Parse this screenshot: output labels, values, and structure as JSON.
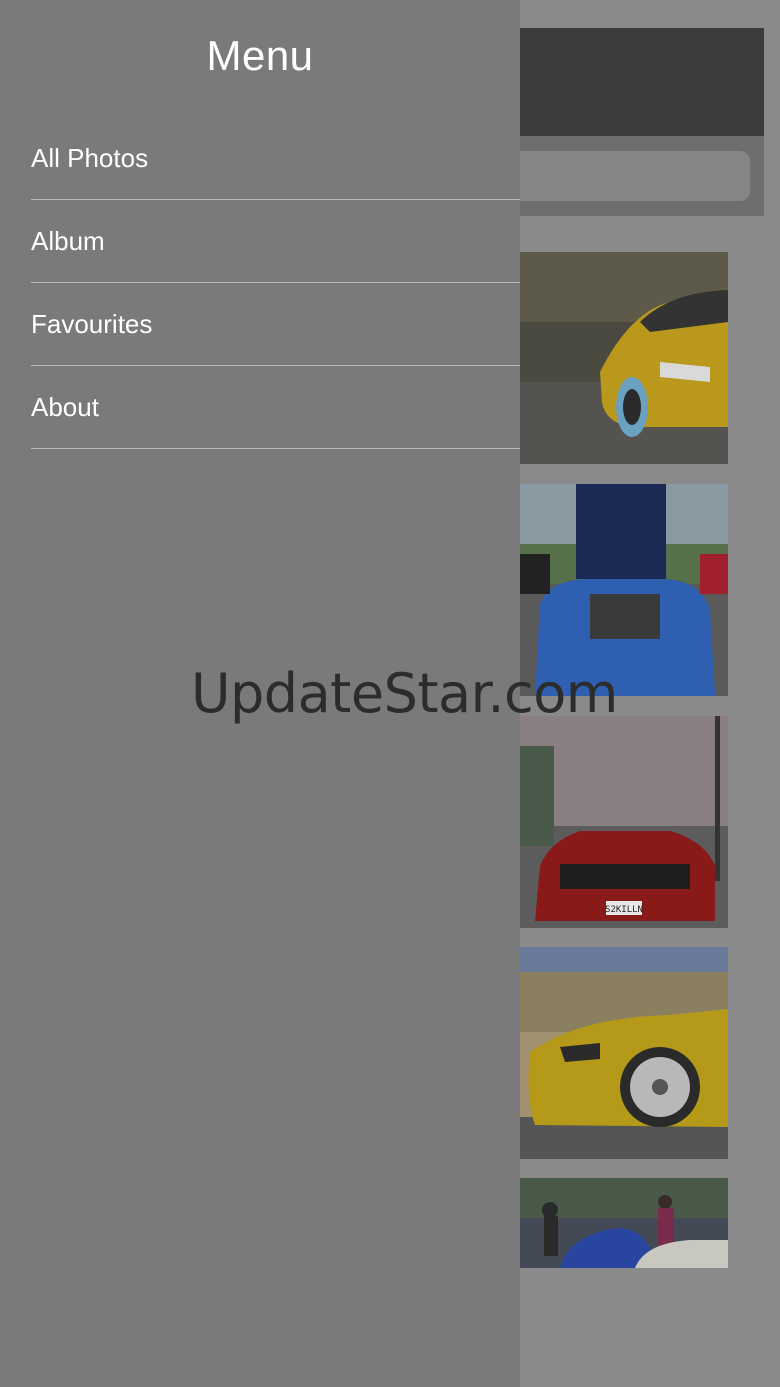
{
  "drawer": {
    "title": "Menu",
    "items": [
      {
        "label": "All Photos"
      },
      {
        "label": "Album"
      },
      {
        "label": "Favourites"
      },
      {
        "label": "About"
      }
    ]
  },
  "gallery": {
    "photos": [
      {
        "subject": "yellow roadster front three-quarter"
      },
      {
        "subject": "blue roadster with hood open"
      },
      {
        "subject": "red roadster rear view",
        "plate_text": "S2KILLN"
      },
      {
        "subject": "yellow roadster side wheel"
      },
      {
        "subject": "car meet crowd"
      }
    ]
  },
  "watermark": {
    "text": "UpdateStar.com"
  },
  "colors": {
    "drawer_bg": "#7a7a7a",
    "header_bg": "#3c3c3c",
    "menu_text": "#ffffff",
    "divider": "#b9b9b9"
  }
}
